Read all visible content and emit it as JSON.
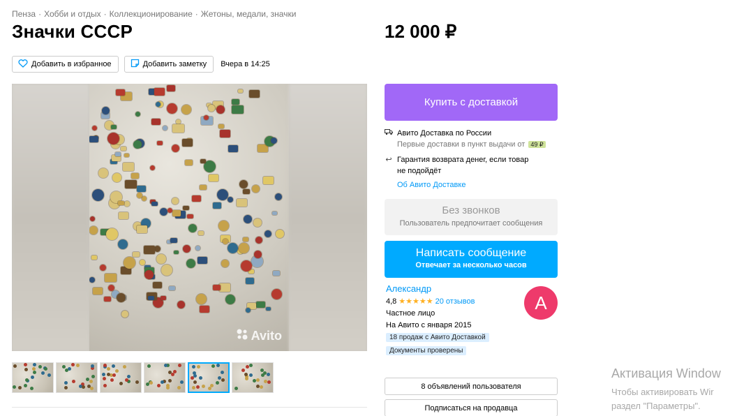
{
  "breadcrumb": [
    "Пенза",
    "Хобби и отдых",
    "Коллекционирование",
    "Жетоны, медали, значки"
  ],
  "title": "Значки СССР",
  "price": "12 000 ₽",
  "actions": {
    "favorite": "Добавить в избранное",
    "note": "Добавить заметку",
    "date": "Вчера в 14:25"
  },
  "gallery": {
    "watermark": "Avito",
    "thumbs_count": 6,
    "active_thumb": 5
  },
  "buy": {
    "label": "Купить с доставкой"
  },
  "delivery": {
    "title": "Авито Доставка по России",
    "subtitle": "Первые доставки в пункт выдачи от",
    "price_badge": "49 ₽",
    "guarantee_line1": "Гарантия возврата денег, если товар",
    "guarantee_line2": "не подойдёт",
    "about_link": "Об Авито Доставке"
  },
  "no_calls": {
    "title": "Без звонков",
    "subtitle": "Пользователь предпочитает сообщения"
  },
  "message": {
    "title": "Написать сообщение",
    "subtitle": "Отвечает за несколько часов"
  },
  "seller": {
    "name": "Александр",
    "rating": "4,8",
    "stars": "★★★★★",
    "reviews": "20 отзывов",
    "type": "Частное лицо",
    "since": "На Авито с января 2015",
    "tag1": "18 продаж с Авито Доставкой",
    "tag2": "Документы проверены",
    "avatar_letter": "А"
  },
  "buttons": {
    "ads": "8 объявлений пользователя",
    "subscribe": "Подписаться на продавца"
  },
  "windows": {
    "line1": "Активация Window",
    "line2": "Чтобы активировать Wir",
    "line3": "раздел \"Параметры\"."
  },
  "colors": {
    "buy": "#a168f7",
    "message": "#00aaff",
    "link": "#0099f7",
    "avatar": "#ee3a6b",
    "stars": "#ffb021"
  }
}
